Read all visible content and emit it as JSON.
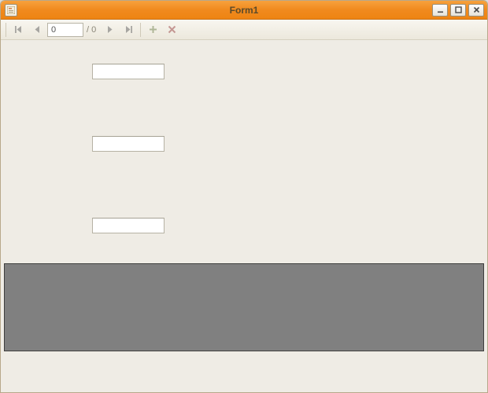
{
  "window": {
    "title": "Form1"
  },
  "navigator": {
    "position": "0",
    "count_text": "/ 0"
  },
  "fields": {
    "textbox1": "",
    "textbox2": "",
    "textbox3": ""
  }
}
